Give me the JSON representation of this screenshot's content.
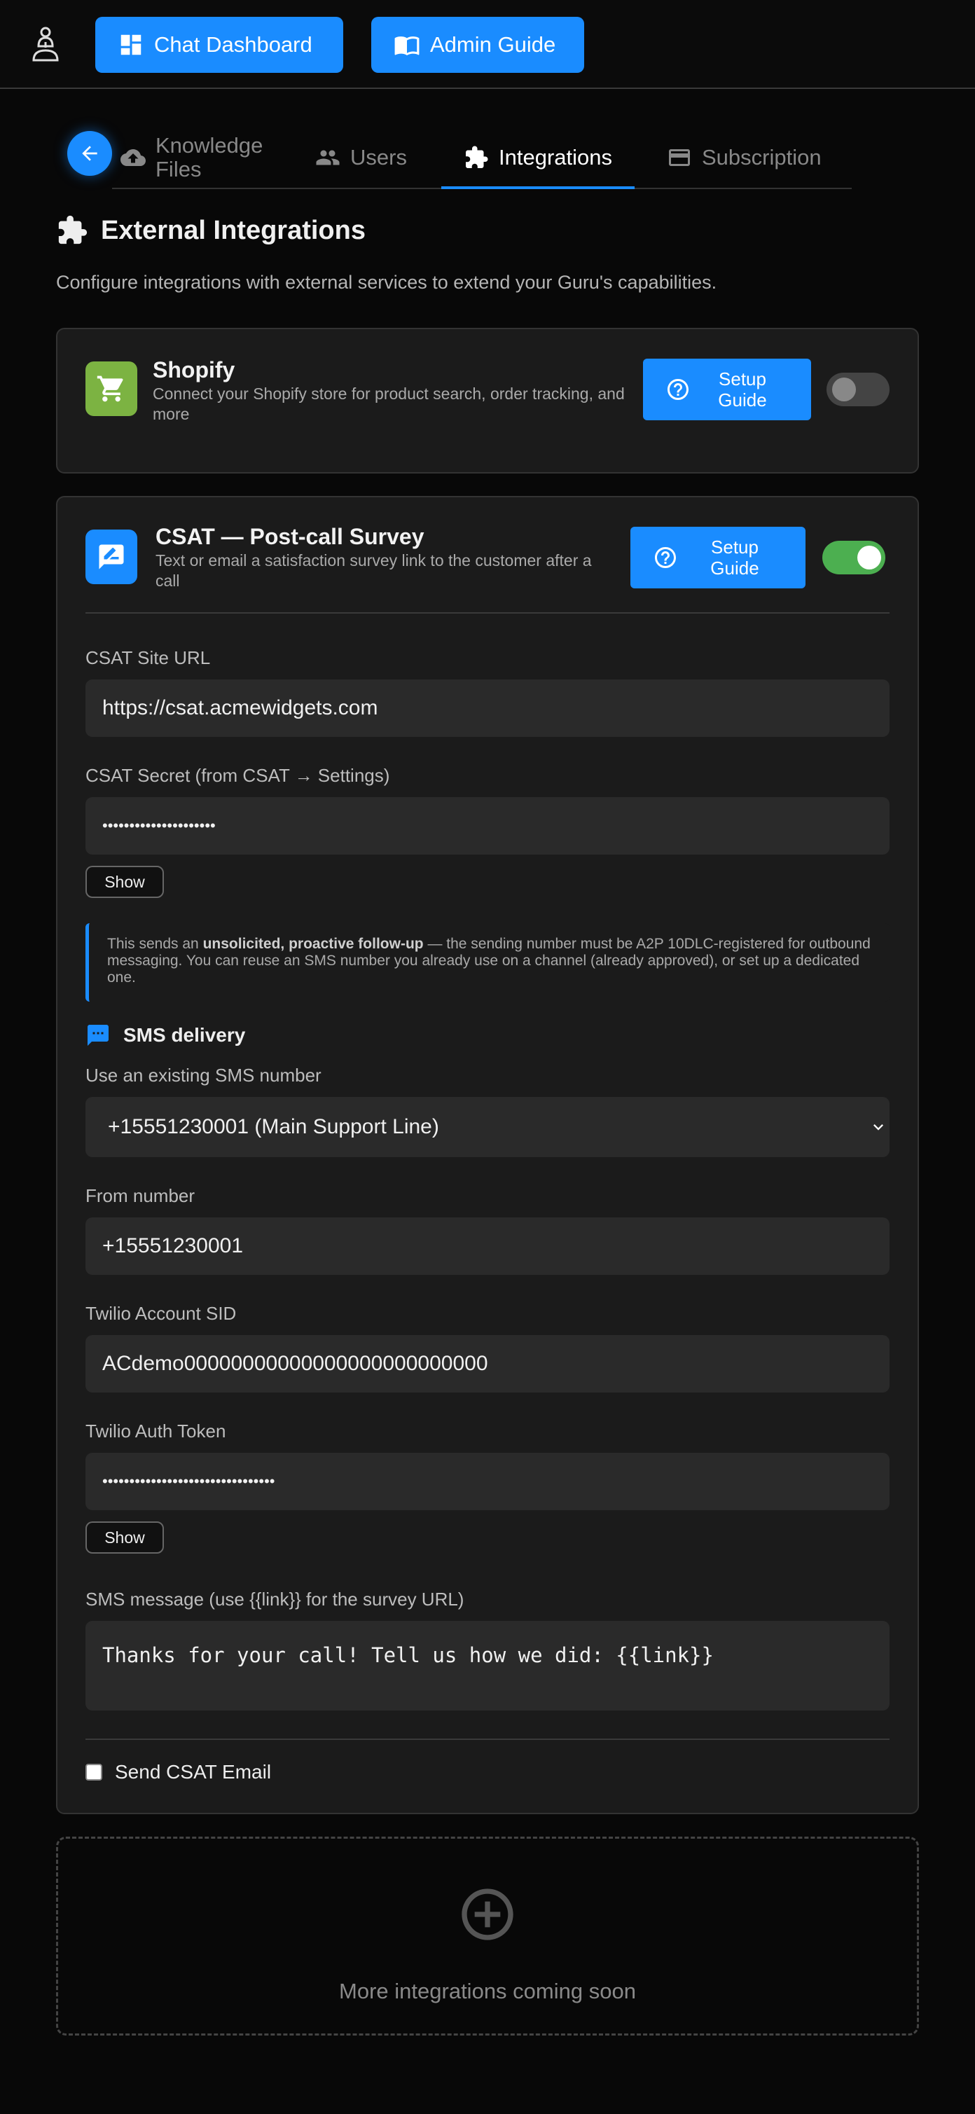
{
  "topbar": {
    "dashboard_label": "Chat Dashboard",
    "admin_label": "Admin Guide"
  },
  "tabs": [
    {
      "label": "Knowledge Files",
      "icon": "cloud-upload-icon"
    },
    {
      "label": "Users",
      "icon": "users-icon"
    },
    {
      "label": "Integrations",
      "icon": "puzzle-icon",
      "active": true
    },
    {
      "label": "Subscription",
      "icon": "credit-card-icon"
    }
  ],
  "section": {
    "title": "External Integrations",
    "description": "Configure integrations with external services to extend your Guru's capabilities."
  },
  "shopify": {
    "name": "Shopify",
    "description": "Connect your Shopify store for product search, order tracking, and more",
    "setup_label": "Setup Guide",
    "enabled": false,
    "icon_color": "#7cb342"
  },
  "csat": {
    "name": "CSAT — Post-call Survey",
    "description": "Text or email a satisfaction survey link to the customer after a call",
    "setup_label": "Setup Guide",
    "enabled": true,
    "toggle_color": "#4caf50",
    "site_url_label": "CSAT Site URL",
    "site_url_value": "https://csat.acmewidgets.com",
    "secret_label": "CSAT Secret (from CSAT → Settings)",
    "secret_value": "•••••••••••••••••••••",
    "show_label": "Show",
    "note_prefix": "This sends an ",
    "note_bold": "unsolicited, proactive follow-up",
    "note_suffix": " — the sending number must be A2P 10DLC-registered for outbound messaging. You can reuse an SMS number you already use on a channel (already approved), or set up a dedicated one.",
    "sms_heading": "SMS delivery",
    "existing_label": "Use an existing SMS number",
    "existing_value": "+15551230001 (Main Support Line)",
    "from_label": "From number",
    "from_value": "+15551230001",
    "sid_label": "Twilio Account SID",
    "sid_value": "ACdemo00000000000000000000000000",
    "token_label": "Twilio Auth Token",
    "token_value": "••••••••••••••••••••••••••••••••",
    "token_show_label": "Show",
    "message_label": "SMS message (use {{link}} for the survey URL)",
    "message_value": "Thanks for your call! Tell us how we did: {{link}}",
    "email_label": "Send CSAT Email",
    "email_checked": false
  },
  "coming_soon": "More integrations coming soon",
  "accent": "#1a8cff"
}
